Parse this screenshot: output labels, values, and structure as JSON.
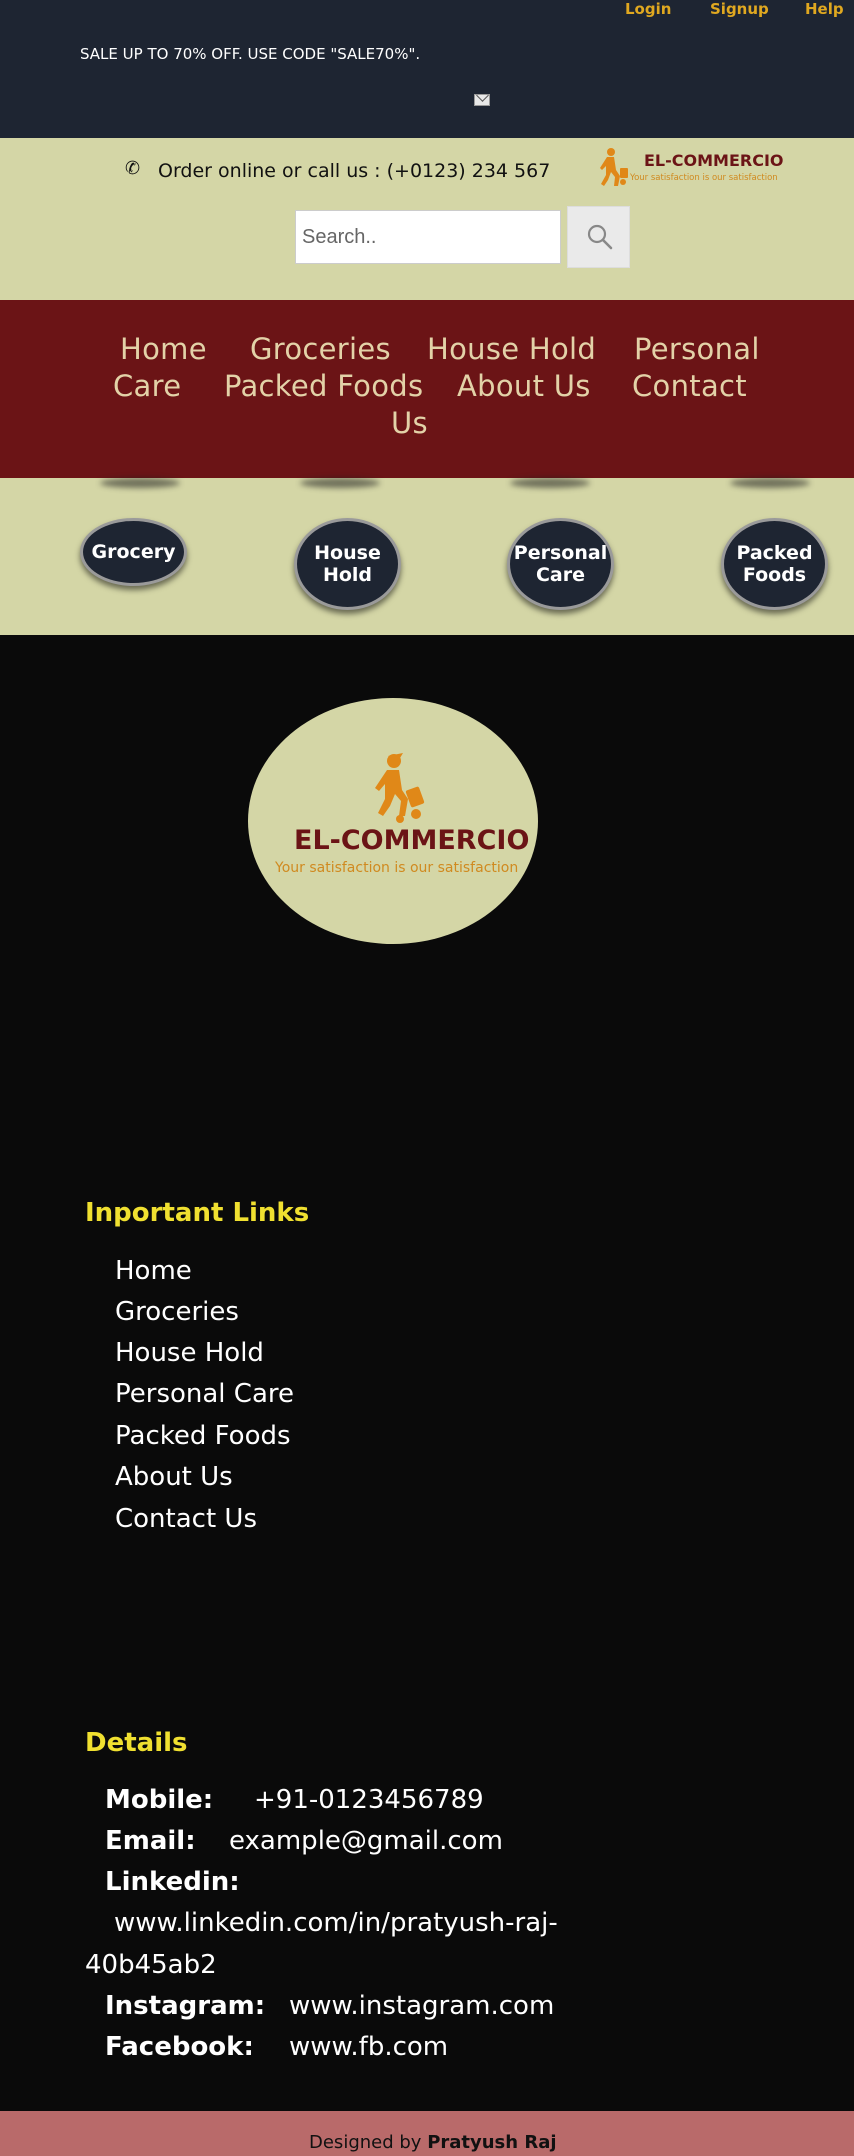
{
  "topbar": {
    "sale_text": "SALE UP TO 70% OFF. USE CODE \"SALE70%\".",
    "links": [
      {
        "label": "Login"
      },
      {
        "label": "Signup"
      },
      {
        "label": "Help"
      }
    ],
    "mail_icon": "envelope-icon"
  },
  "header": {
    "phone_icon": "phone-icon",
    "order_text": "Order online or call us : (+0123) 234 567",
    "logo_title": "EL-COMMERCIO",
    "logo_tagline": "Your satisfaction is our satisfaction",
    "search": {
      "placeholder": "Search..",
      "button_icon": "search-icon"
    }
  },
  "nav": {
    "items": [
      {
        "label": "Home"
      },
      {
        "label": "Groceries"
      },
      {
        "label": "House Hold"
      },
      {
        "label": "Personal"
      },
      {
        "label": "Care"
      },
      {
        "label": "Packed Foods"
      },
      {
        "label": "About Us"
      },
      {
        "label": "Contact"
      },
      {
        "label": "Us"
      }
    ]
  },
  "categories": [
    {
      "line1": "Grocery",
      "line2": ""
    },
    {
      "line1": "House",
      "line2": "Hold"
    },
    {
      "line1": "Personal",
      "line2": "Care"
    },
    {
      "line1": "Packed",
      "line2": "Foods"
    }
  ],
  "footer": {
    "logo_title": "EL-COMMERCIO",
    "logo_tagline": "Your satisfaction is our satisfaction",
    "links_heading": "Inportant Links",
    "links": [
      {
        "label": "Home"
      },
      {
        "label": "Groceries"
      },
      {
        "label": "House Hold"
      },
      {
        "label": "Personal Care"
      },
      {
        "label": "Packed Foods"
      },
      {
        "label": "About Us"
      },
      {
        "label": "Contact Us"
      }
    ],
    "details_heading": "Details",
    "details": {
      "mobile_label": "Mobile:",
      "mobile_value": "+91-0123456789",
      "email_label": "Email:",
      "email_value": "example@gmail.com",
      "linkedin_label": "Linkedin:",
      "linkedin_value_line1": "www.linkedin.com/in/pratyush-raj-",
      "linkedin_value_line2": "40b45ab2",
      "instagram_label": "Instagram:",
      "instagram_value": "www.instagram.com",
      "facebook_label": "Facebook:",
      "facebook_value": "www.fb.com"
    },
    "credit_prefix": "Designed by",
    "credit_name": "Pratyush Raj"
  },
  "colors": {
    "topbar_bg": "#1e2532",
    "accent_gold": "#e0a820",
    "band_bg": "#d4d6a6",
    "nav_bg": "#6b1416",
    "nav_text": "#e3d2a8",
    "heading_yellow": "#f0e030",
    "footer_bottom": "#b96a6a"
  }
}
